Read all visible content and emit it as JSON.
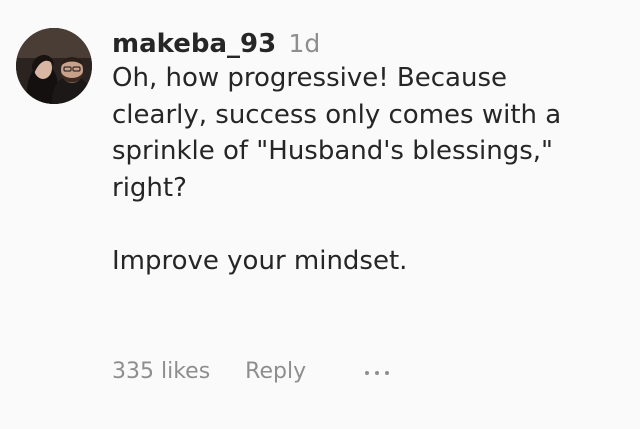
{
  "comment": {
    "username": "makeba_93",
    "timestamp": "1d",
    "avatar_icon": "avatar-photo-icon",
    "text_lines": [
      "Oh, how progressive! Because",
      "clearly, success only comes with a",
      "sprinkle of \"Husband's blessings,\"",
      "right?"
    ],
    "text_lines_2": [
      "Improve your mindset."
    ],
    "likes_label": "335 likes",
    "reply_label": "Reply",
    "more_icon": "more-options-icon"
  },
  "colors": {
    "background": "#fafafa",
    "primary_text": "#262626",
    "secondary_text": "#8e8e8e"
  }
}
